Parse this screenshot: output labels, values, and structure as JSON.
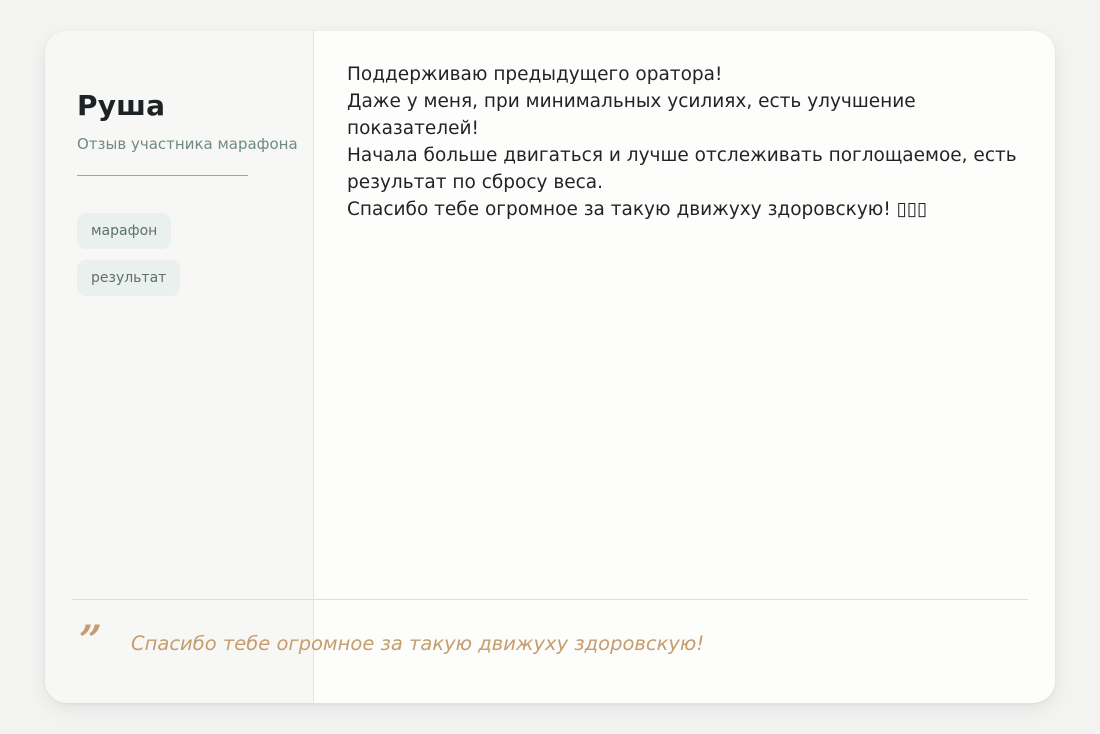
{
  "sidebar": {
    "author": "Руша",
    "subtitle": "Отзыв участника марафона",
    "tags": [
      "марафон",
      "результат"
    ]
  },
  "review": {
    "lines": [
      "Поддерживаю предыдущего оратора!",
      "Даже у меня, при минимальных усилиях, есть улучшение",
      "показателей!",
      "Начала больше двигаться и лучше отслеживать поглощаемое, есть",
      "результат по сбросу веса.",
      "Спасибо тебе огромное за такую движуху здоровскую! ▯▯▯"
    ]
  },
  "quote": {
    "mark": "”",
    "text": "Спасибо тебе огромное за такую движуху здоровскую!"
  },
  "colors": {
    "accent": "#c59d6e",
    "subtitle": "#6f8a84",
    "tag_bg": "#eaf0ed"
  }
}
